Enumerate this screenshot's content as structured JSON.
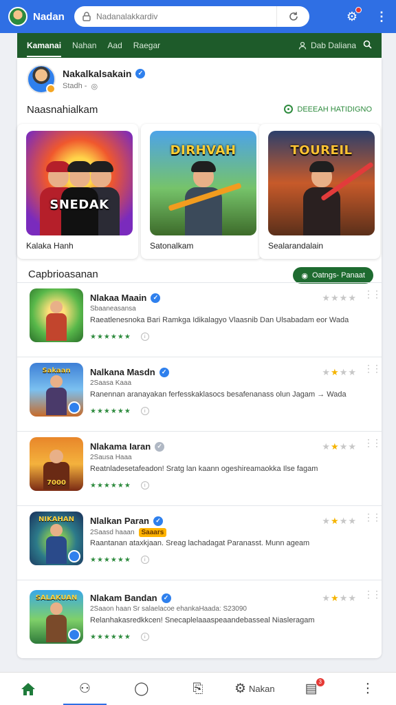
{
  "topbar": {
    "title": "Nadan",
    "url_placeholder": "Nadanalakkardiv"
  },
  "nav": {
    "tabs": [
      "Kamanai",
      "Nahan",
      "Aad",
      "Raegar"
    ],
    "user_label": "Dab Daliana"
  },
  "profile": {
    "name": "Nakalkalsakain",
    "sub": "Stadh -"
  },
  "featured": {
    "title": "Naasnahialkam",
    "link": "DEEEAH HATIDIGNO",
    "cards": [
      {
        "art_title": "SNEDAK",
        "label": "Kalaka Hanh"
      },
      {
        "art_title": "DIRHVAH",
        "label": "Satonalkam"
      },
      {
        "art_title": "TOUREIL",
        "label": "Sealarandalain"
      }
    ]
  },
  "list": {
    "title": "Capbrioasanan",
    "button": "Oatngs- Panaat",
    "items": [
      {
        "title": "Nlakaa Maain",
        "meta": "Sbaaneasansa",
        "tag": "",
        "desc": "Raeatlenesnoka Bari Ramkga Idikalagyo Vlaasnib Dan Ulsabadam eor Wada",
        "rating": 0,
        "banner": ""
      },
      {
        "title": "Nalkana Masdn",
        "meta": "2Saasa Kaaa",
        "tag": "",
        "desc": "Ranennan aranayakan ferfesskaklasocs besafenanass olun Jagam → Wada",
        "rating": 1,
        "banner": "Sakaan"
      },
      {
        "title": "Nlakama Iaran",
        "meta": "2Sausa Haaa",
        "tag": "",
        "desc": "Reatnladesetafeadon! Sratg lan kaann ogeshireamaokka Ilse fagam",
        "rating": 1,
        "banner": "7000"
      },
      {
        "title": "Nlalkan Paran",
        "meta": "2Saasd haaan",
        "tag": "Saaars",
        "desc": "Raantanan ataxkjaan. Sreag lachadagat Paranasst. Munn ageam",
        "rating": 1,
        "banner": "NIKAHAN"
      },
      {
        "title": "Nlakam Bandan",
        "meta": "2Saaon haan  Sr salaelacoe ehankaHaada:  S23090",
        "tag": "",
        "desc": "Relanhakasredkkcen! Snecaplelaaaspeaandebasseal Niasleragam",
        "rating": 1,
        "banner": "SALAKUAN"
      }
    ]
  },
  "bottomnav": {
    "label": "Nakan",
    "badge": "3"
  }
}
